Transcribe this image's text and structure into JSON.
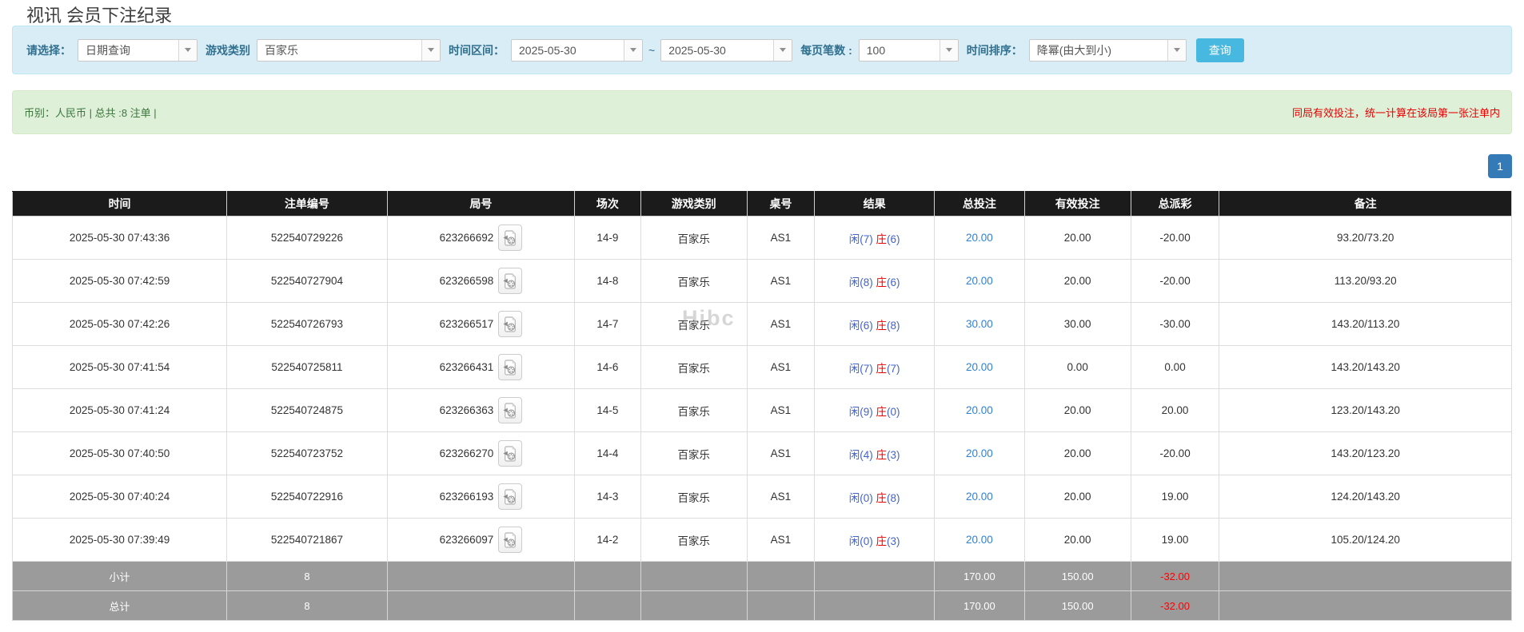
{
  "page": {
    "title": "视讯 会员下注纪录",
    "watermark": "Hibc"
  },
  "filters": {
    "select_label": "请选择：",
    "select_value": "日期查询",
    "game_type_label": "游戏类别",
    "game_type_value": "百家乐",
    "time_range_label": "时间区间：",
    "date_from": "2025-05-30",
    "range_separator": "~",
    "date_to": "2025-05-30",
    "page_size_label": "每页笔数 :",
    "page_size_value": "100",
    "sort_label": "时间排序：",
    "sort_value": "降幂(由大到小)",
    "query_button": "查询"
  },
  "summary_bar": {
    "left_text": "币别：人民币 | 总共 :8 注单 |",
    "right_note": "同局有效投注，统一计算在该局第一张注单内"
  },
  "pagination": {
    "current_page": "1"
  },
  "table": {
    "headers": [
      "时间",
      "注单编号",
      "局号",
      "场次",
      "游戏类别",
      "桌号",
      "结果",
      "总投注",
      "有效投注",
      "总派彩",
      "备注"
    ],
    "rows": [
      {
        "time": "2025-05-30 07:43:36",
        "bet_id": "522540729226",
        "round_id": "623266692",
        "session": "14-9",
        "game_type": "百家乐",
        "table_no": "AS1",
        "result_player": "闲(7)",
        "result_banker": "庄",
        "result_banker_pts": "(6)",
        "total_bet": "20.00",
        "valid_bet": "20.00",
        "payout": "-20.00",
        "remark": "93.20/73.20"
      },
      {
        "time": "2025-05-30 07:42:59",
        "bet_id": "522540727904",
        "round_id": "623266598",
        "session": "14-8",
        "game_type": "百家乐",
        "table_no": "AS1",
        "result_player": "闲(8)",
        "result_banker": "庄",
        "result_banker_pts": "(6)",
        "total_bet": "20.00",
        "valid_bet": "20.00",
        "payout": "-20.00",
        "remark": "113.20/93.20"
      },
      {
        "time": "2025-05-30 07:42:26",
        "bet_id": "522540726793",
        "round_id": "623266517",
        "session": "14-7",
        "game_type": "百家乐",
        "table_no": "AS1",
        "result_player": "闲(6)",
        "result_banker": "庄",
        "result_banker_pts": "(8)",
        "total_bet": "30.00",
        "valid_bet": "30.00",
        "payout": "-30.00",
        "remark": "143.20/113.20"
      },
      {
        "time": "2025-05-30 07:41:54",
        "bet_id": "522540725811",
        "round_id": "623266431",
        "session": "14-6",
        "game_type": "百家乐",
        "table_no": "AS1",
        "result_player": "闲(7)",
        "result_banker": "庄",
        "result_banker_pts": "(7)",
        "total_bet": "20.00",
        "valid_bet": "0.00",
        "payout": "0.00",
        "remark": "143.20/143.20"
      },
      {
        "time": "2025-05-30 07:41:24",
        "bet_id": "522540724875",
        "round_id": "623266363",
        "session": "14-5",
        "game_type": "百家乐",
        "table_no": "AS1",
        "result_player": "闲(9)",
        "result_banker": "庄",
        "result_banker_pts": "(0)",
        "total_bet": "20.00",
        "valid_bet": "20.00",
        "payout": "20.00",
        "remark": "123.20/143.20"
      },
      {
        "time": "2025-05-30 07:40:50",
        "bet_id": "522540723752",
        "round_id": "623266270",
        "session": "14-4",
        "game_type": "百家乐",
        "table_no": "AS1",
        "result_player": "闲(4)",
        "result_banker": "庄",
        "result_banker_pts": "(3)",
        "total_bet": "20.00",
        "valid_bet": "20.00",
        "payout": "-20.00",
        "remark": "143.20/123.20"
      },
      {
        "time": "2025-05-30 07:40:24",
        "bet_id": "522540722916",
        "round_id": "623266193",
        "session": "14-3",
        "game_type": "百家乐",
        "table_no": "AS1",
        "result_player": "闲(0)",
        "result_banker": "庄",
        "result_banker_pts": "(8)",
        "total_bet": "20.00",
        "valid_bet": "20.00",
        "payout": "19.00",
        "remark": "124.20/143.20"
      },
      {
        "time": "2025-05-30 07:39:49",
        "bet_id": "522540721867",
        "round_id": "623266097",
        "session": "14-2",
        "game_type": "百家乐",
        "table_no": "AS1",
        "result_player": "闲(0)",
        "result_banker": "庄",
        "result_banker_pts": "(3)",
        "total_bet": "20.00",
        "valid_bet": "20.00",
        "payout": "19.00",
        "remark": "105.20/124.20"
      }
    ],
    "footer": [
      {
        "label": "小计",
        "count": "8",
        "total_bet": "170.00",
        "valid_bet": "150.00",
        "payout": "-32.00"
      },
      {
        "label": "总计",
        "count": "8",
        "total_bet": "170.00",
        "valid_bet": "150.00",
        "payout": "-32.00"
      }
    ]
  },
  "colors": {
    "panel_bg": "#d9edf7",
    "panel_border": "#bce8f1",
    "label_color": "#31708f",
    "button_cyan": "#47b8e0",
    "info_bg": "#dff0d8",
    "info_border": "#d6e9c6",
    "info_text": "#3c763d",
    "warn_red": "#e60000",
    "header_bg": "#1b1b1b",
    "pagination_blue": "#337ab7",
    "amount_blue": "#2e81d6",
    "result_blue": "#4263c8",
    "result_red": "#e60000",
    "negative_red": "#ff0000",
    "footer_bg": "#9b9b9b"
  }
}
